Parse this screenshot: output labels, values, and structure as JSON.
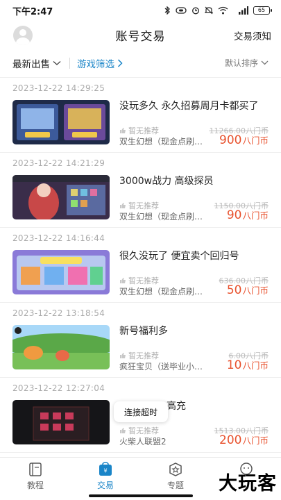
{
  "status_bar": {
    "time": "下午2:47",
    "network_label": "5G",
    "battery": "65"
  },
  "header": {
    "title": "账号交易",
    "notice_link": "交易须知"
  },
  "filters": {
    "latest_label": "最新出售",
    "game_filter_label": "游戏筛选",
    "sort_label": "默认排序"
  },
  "listings": [
    {
      "date": "2023-12-22 14:29:25",
      "title": "没玩多久 永久招募周月卡都买了",
      "recommend": "暂无推荐",
      "game": "双生幻想（现金点刷…",
      "original_price": "11266.00八门币",
      "price": "900",
      "unit": "八门币"
    },
    {
      "date": "2023-12-22 14:21:29",
      "title": "3000w战力 高级探员",
      "recommend": "暂无推荐",
      "game": "双生幻想（现金点刷…",
      "original_price": "1150.00八门币",
      "price": "90",
      "unit": "八门币"
    },
    {
      "date": "2023-12-22 14:16:44",
      "title": "很久没玩了 便宜卖个回归号",
      "recommend": "暂无推荐",
      "game": "双生幻想（现金点刷…",
      "original_price": "636.00八门币",
      "price": "50",
      "unit": "八门币"
    },
    {
      "date": "2023-12-22 13:18:54",
      "title": "新号福利多",
      "recommend": "暂无推荐",
      "game": "疯狂宝贝（送毕业小…",
      "original_price": "6.00八门币",
      "price": "10",
      "unit": "八门币"
    },
    {
      "date": "2023-12-22 12:27:04",
      "title": "高充",
      "recommend": "暂无推荐",
      "game": "火柴人联盟2",
      "original_price": "1513.00八门币",
      "price": "200",
      "unit": "八门币"
    }
  ],
  "toast": {
    "message": "连接超时"
  },
  "tabbar": {
    "tabs": [
      {
        "label": "教程",
        "icon": "book-icon"
      },
      {
        "label": "交易",
        "icon": "trade-bag-icon",
        "active": true
      },
      {
        "label": "专题",
        "icon": "star-badge-icon"
      },
      {
        "label": "",
        "icon": "chat-face-icon"
      }
    ]
  },
  "watermark": "大玩客",
  "colors": {
    "accent_blue": "#1a85c8",
    "price_red": "#e8512d"
  }
}
